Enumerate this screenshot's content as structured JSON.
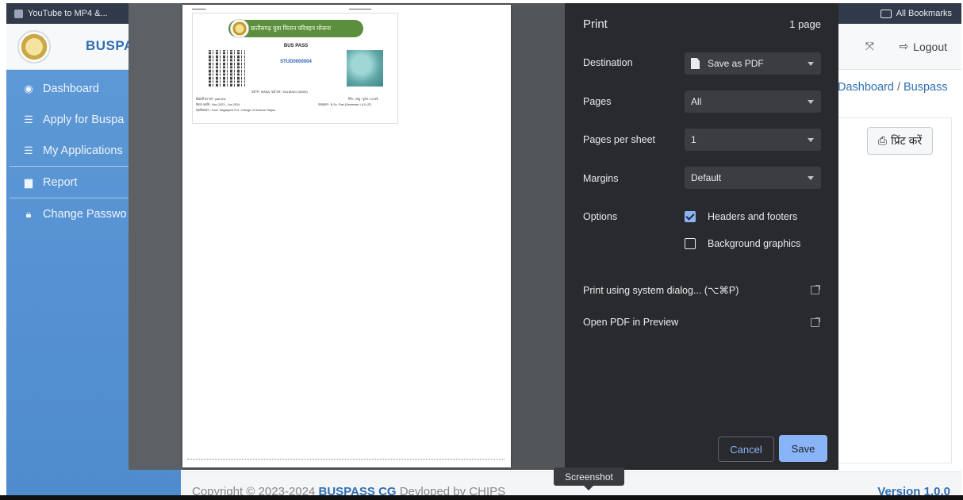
{
  "browser": {
    "bookmark_item": "YouTube to MP4 &...",
    "all_bookmarks": "All Bookmarks"
  },
  "app": {
    "brand": "BUSPA",
    "logout_label": "Logout",
    "sidebar": [
      {
        "label": "Dashboard",
        "icon": "dashboard-icon"
      },
      {
        "label": "Apply for Buspa",
        "icon": "list-icon"
      },
      {
        "label": "My Applications",
        "icon": "list-icon"
      },
      {
        "label": "Report",
        "icon": "file-icon"
      },
      {
        "label": "Change Passwo",
        "icon": "lock-icon"
      }
    ],
    "breadcrumb": {
      "home": "Dashboard",
      "separator": "/",
      "current": "Buspass"
    },
    "print_button": "प्रिंट करें",
    "footer": {
      "copyright_prefix": "Copyright © 2023-2024 ",
      "copyright_brand": "BUSPASS CG",
      "developed": " Devloped by CHIPS",
      "version": "Version 1.0.0"
    }
  },
  "print_dialog": {
    "title": "Print",
    "page_count": "1 page",
    "destination": {
      "label": "Destination",
      "value": "Save as PDF"
    },
    "pages": {
      "label": "Pages",
      "value": "All"
    },
    "pages_per_sheet": {
      "label": "Pages per sheet",
      "value": "1"
    },
    "margins": {
      "label": "Margins",
      "value": "Default"
    },
    "options": {
      "label": "Options",
      "headers_footers": {
        "label": "Headers and footers",
        "checked": true
      },
      "background_graphics": {
        "label": "Background graphics",
        "checked": false
      }
    },
    "system_dialog": "Print using system dialog... (⌥⌘P)",
    "open_pdf": "Open PDF in Preview",
    "cancel": "Cancel",
    "save": "Save"
  },
  "preview_page": {
    "banner": "छत्तीसगढ़ युवा मितान परिवहन योजना",
    "title": "BUS PASS",
    "student_id": "STUD0000004",
    "line1_left": "विद्यार्थी का नाम : jast test",
    "line1_mid": "यहाँ से : MANA, यहाँ तक : KALIBADI (15000)",
    "line1_right": "लिंग / आयु : पुरुष / 13 वर्ष",
    "line2_left": "वैधता अवधि : Nov 2023 - Jun 2024",
    "line2_right": "पाठ्यक्रम : B.Sc. Part (Semester I & II (IT)",
    "line3_left": "महाविद्यालय : Govt. Nagarjuna P.G. College of Science Raipur"
  },
  "tooltip": "Screenshot",
  "colors": {
    "sidebar": "#5d98d6",
    "brand_blue": "#2f6fb3",
    "dialog_bg": "#292a2d",
    "accent": "#8ab4f8",
    "banner_green": "#5c8f3b"
  }
}
